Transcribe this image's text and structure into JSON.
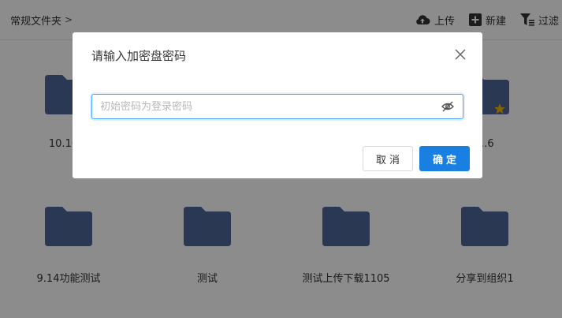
{
  "header": {
    "breadcrumb": "常规文件夹",
    "upload_label": "上传",
    "new_label": "新建",
    "filter_label": "过滤"
  },
  "folders": [
    {
      "name": "10.10…"
    },
    {
      "name": "…6"
    },
    {
      "name": "9.14功能测试"
    },
    {
      "name": "测试"
    },
    {
      "name": "测试上传下载1105"
    },
    {
      "name": "分享到组织1"
    }
  ],
  "dialog": {
    "title": "请输入加密盘密码",
    "password_placeholder": "初始密码为登录密码",
    "password_value": "",
    "cancel_label": "取消",
    "ok_label": "确定"
  },
  "colors": {
    "folder": "#4f6698",
    "primary": "#1a7fe2",
    "input_border": "#4aa3ff",
    "star": "#f0b400"
  }
}
